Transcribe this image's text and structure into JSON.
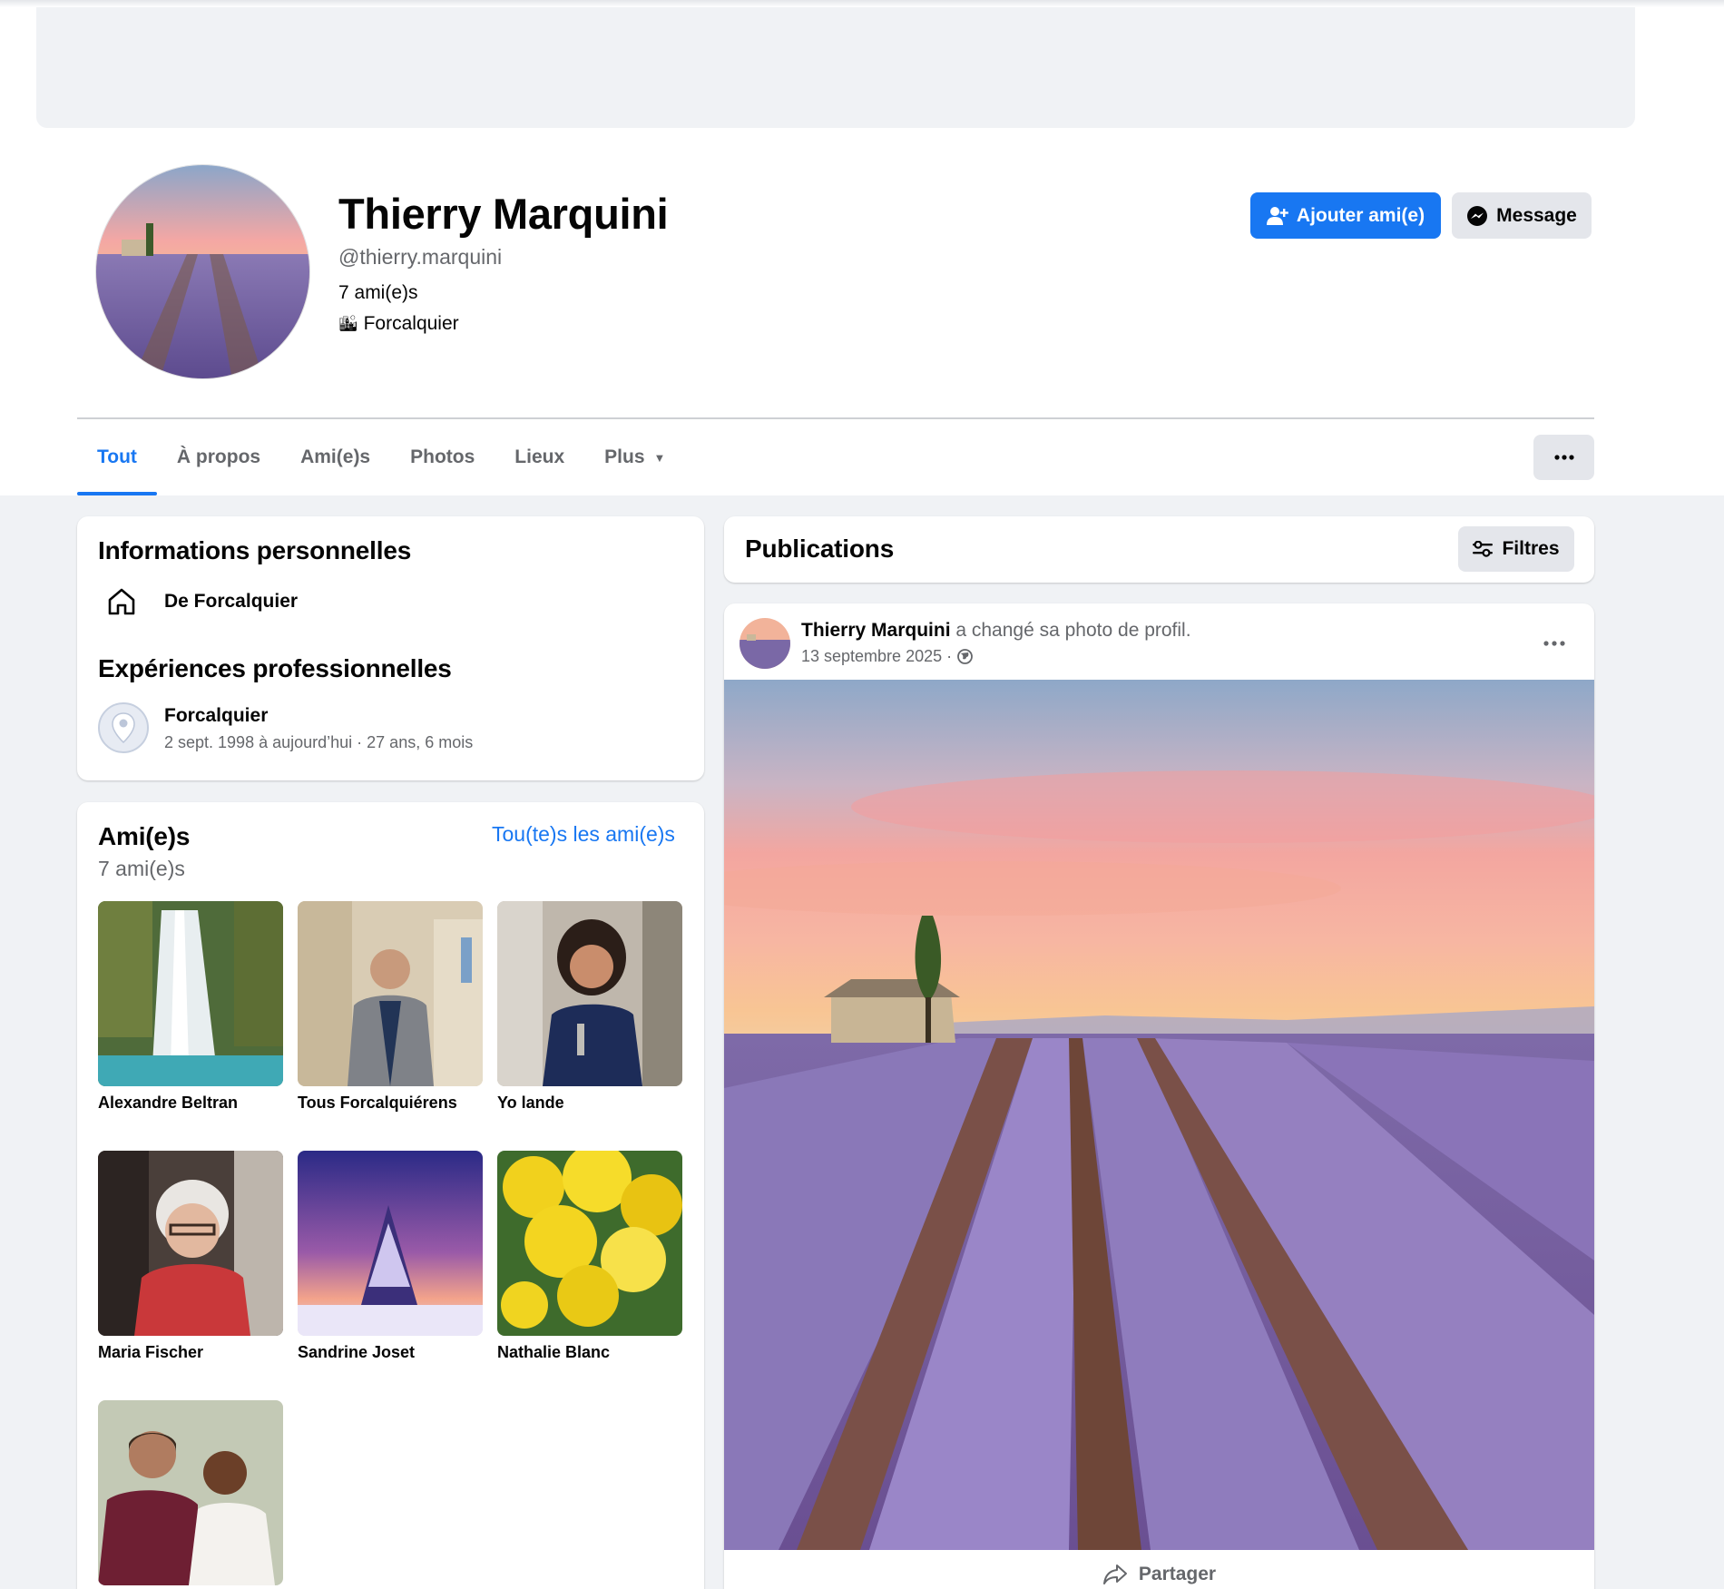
{
  "profile": {
    "name": "Thierry Marquini",
    "handle": "@thierry.marquini",
    "friends_count": "7 ami(e)s",
    "city_icon": "🏙",
    "city": "Forcalquier",
    "add_friend_label": "Ajouter ami(e)",
    "message_label": "Message"
  },
  "tabs": [
    {
      "label": "Tout"
    },
    {
      "label": "À propos"
    },
    {
      "label": "Ami(e)s"
    },
    {
      "label": "Photos"
    },
    {
      "label": "Lieux"
    },
    {
      "label": "Plus"
    }
  ],
  "info": {
    "title": "Informations personnelles",
    "hometown": "De Forcalquier",
    "work_title": "Expériences professionnelles",
    "work_place": "Forcalquier",
    "work_dates": "2 sept. 1998 à aujourd’hui · 27 ans, 6 mois"
  },
  "friends": {
    "title": "Ami(e)s",
    "count": "7 ami(e)s",
    "see_all": "Tou(te)s les ami(e)s",
    "items": [
      {
        "name": "Alexandre Beltran"
      },
      {
        "name": "Tous Forcalquiérens"
      },
      {
        "name": "Yo lande"
      },
      {
        "name": "Maria Fischer"
      },
      {
        "name": "Sandrine Joset"
      },
      {
        "name": "Nathalie Blanc"
      },
      {
        "name": ""
      }
    ]
  },
  "publications": {
    "title": "Publications",
    "filters_label": "Filtres"
  },
  "post": {
    "author": "Thierry Marquini",
    "action": " a changé sa photo de profil.",
    "date": "13 septembre 2025 ·",
    "share_label": "Partager"
  },
  "colors": {
    "accent": "#1877f2",
    "background": "#f0f2f5",
    "secondary_text": "#65676b",
    "button_gray": "#e4e6eb"
  }
}
